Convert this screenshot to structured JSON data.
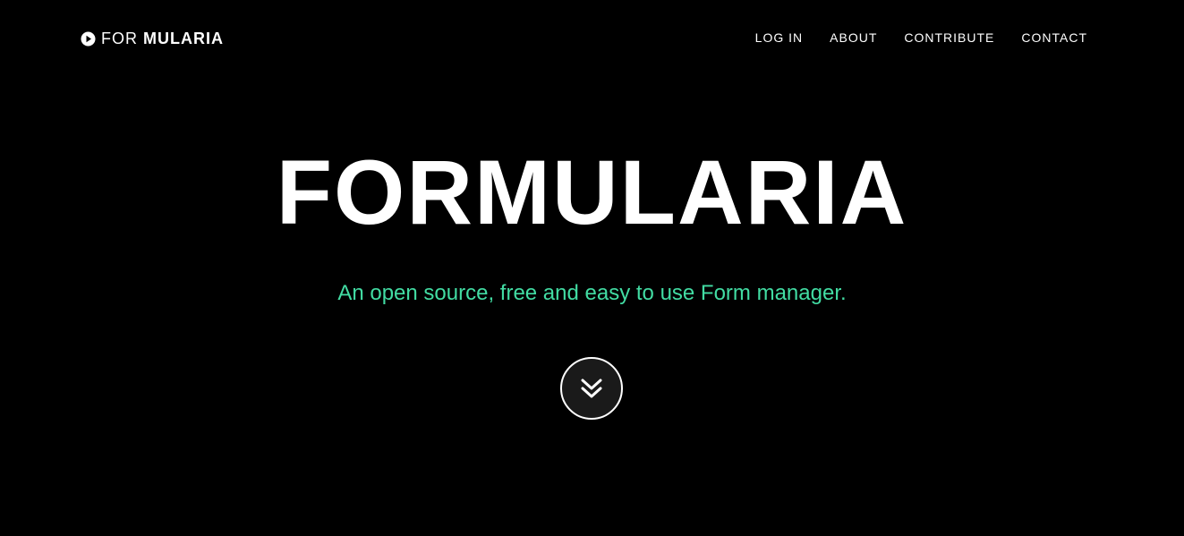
{
  "brand": {
    "light": "FOR",
    "bold": "MULARIA",
    "icon": "play-circle-icon"
  },
  "nav": {
    "items": [
      {
        "label": "LOG IN"
      },
      {
        "label": "ABOUT"
      },
      {
        "label": "CONTRIBUTE"
      },
      {
        "label": "CONTACT"
      }
    ]
  },
  "hero": {
    "title": "FORMULARIA",
    "subtitle": "An open source, free and easy to use Form manager.",
    "scroll_icon": "double-chevron-down-icon"
  },
  "colors": {
    "background": "#000000",
    "text": "#ffffff",
    "accent": "#42dca3",
    "button_bg": "#1a1a1a"
  }
}
